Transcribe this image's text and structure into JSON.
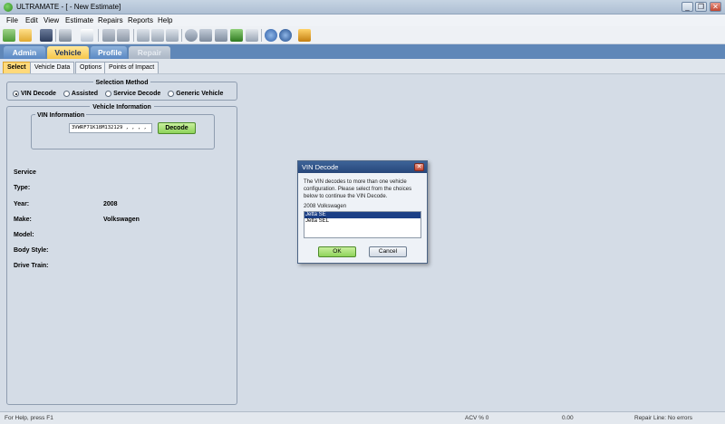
{
  "window": {
    "title": "ULTRAMATE - [ - New Estimate]",
    "minimize_glyph": "_",
    "restore_glyph": "❐",
    "close_glyph": "✕"
  },
  "menu": [
    "File",
    "Edit",
    "View",
    "Estimate",
    "Repairs",
    "Reports",
    "Help"
  ],
  "main_tabs": [
    "Admin",
    "Vehicle",
    "Profile",
    "Repair"
  ],
  "sub_tabs": [
    "Select",
    "Vehicle Data",
    "Options",
    "Points of Impact"
  ],
  "selection_method": {
    "title": "Selection Method",
    "options": [
      "VIN Decode",
      "Assisted",
      "Service Decode",
      "Generic Vehicle"
    ],
    "selected": "VIN Decode"
  },
  "vehicle_information": {
    "title": "Vehicle Information",
    "vin_group_title": "VIN Information",
    "vin_value": "3VWRF71K18M132129 , , , ,",
    "decode_label": "Decode",
    "fields": [
      {
        "label": "Service",
        "value": ""
      },
      {
        "label": "Type:",
        "value": ""
      },
      {
        "label": "Year:",
        "value": "2008"
      },
      {
        "label": "Make:",
        "value": "Volkswagen"
      },
      {
        "label": "Model:",
        "value": ""
      },
      {
        "label": "Body Style:",
        "value": ""
      },
      {
        "label": "Drive Train:",
        "value": ""
      }
    ]
  },
  "dialog": {
    "title": "VIN Decode",
    "close_glyph": "✕",
    "message": "The VIN decodes to more than one vehicle configuration. Please select from the choices below to continue the VIN Decode.",
    "list_label": "2008 Volkswagen",
    "options": [
      "Jetta SE",
      "Jetta SEL"
    ],
    "selected_index": 0,
    "ok_label": "OK",
    "cancel_label": "Cancel"
  },
  "status": {
    "help": "For Help, press F1",
    "acv": "ACV % 0",
    "amount": "0.00",
    "repair_line": "Repair Line: No errors"
  },
  "toolbar_icons": [
    "new-icon",
    "open-icon",
    "save-icon",
    "print-icon",
    "report-icon",
    "copy-icon",
    "paste-icon",
    "list-icon",
    "grid-icon",
    "table-icon",
    "search-icon",
    "database-icon",
    "calculator-icon",
    "monitor-icon",
    "card-icon",
    "web-icon",
    "help-icon",
    "tools-icon"
  ]
}
